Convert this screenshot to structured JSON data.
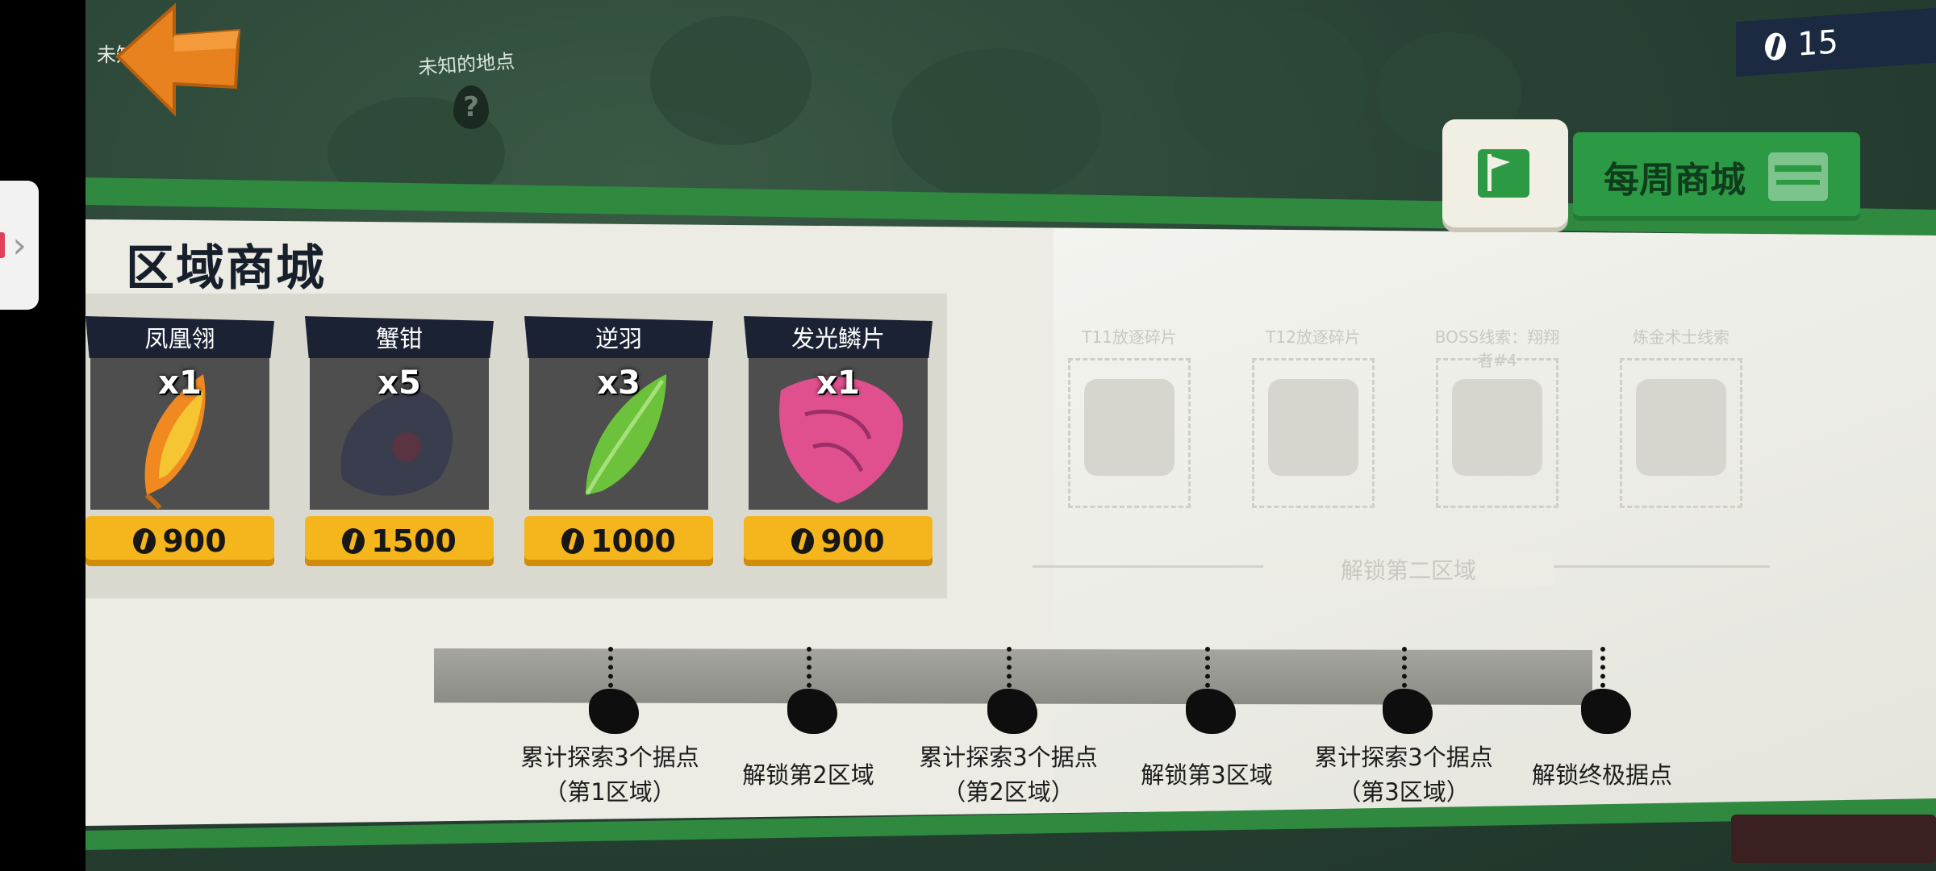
{
  "top_bar": {
    "corner_label": "未知",
    "unknown_location": "未知的地点",
    "unknown_marker": "?",
    "currency_value": "15"
  },
  "tabs": {
    "weekly_shop": "每周商城"
  },
  "region_shop": {
    "title": "区域商城",
    "items": [
      {
        "name": "凤凰翎",
        "qty": "x1",
        "price": "900",
        "color": "#e8562a"
      },
      {
        "name": "蟹钳",
        "qty": "x5",
        "price": "1500",
        "color": "#3a3d4e"
      },
      {
        "name": "逆羽",
        "qty": "x3",
        "price": "1000",
        "color": "#6cc23a"
      },
      {
        "name": "发光鳞片",
        "qty": "x1",
        "price": "900",
        "color": "#e0508e"
      }
    ],
    "locked_items": [
      {
        "name": "T11放逐碎片"
      },
      {
        "name": "T12放逐碎片"
      },
      {
        "name": "BOSS线索：翔翔者#4"
      },
      {
        "name": "炼金术士线索"
      }
    ],
    "locked_hint": "解锁第二区域"
  },
  "progress": {
    "milestones": [
      {
        "label": "累计探索3个据点（第1区域）"
      },
      {
        "label": "解锁第2区域"
      },
      {
        "label": "累计探索3个据点（第2区域）"
      },
      {
        "label": "解锁第3区域"
      },
      {
        "label": "累计探索3个据点（第3区域）"
      },
      {
        "label": "解锁终极据点"
      }
    ]
  },
  "colors": {
    "accent_green": "#2f8a3f",
    "price_gold": "#f5b51d",
    "back_orange": "#e8821e"
  }
}
